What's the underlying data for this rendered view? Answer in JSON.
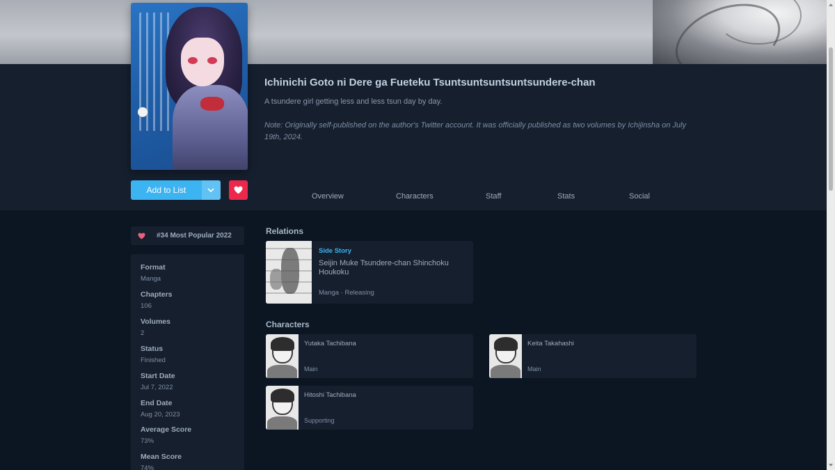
{
  "media": {
    "title": "Ichinichi Goto ni Dere ga Fueteku Tsuntsuntsuntsuntsundere-chan",
    "description": "A tsundere girl getting less and less tsun day by day.",
    "note": "Note: Originally self-published on the author's Twitter account. It was officially published as two volumes by Ichijinsha on July 19th, 2024."
  },
  "actions": {
    "add_label": "Add to List",
    "dropdown_icon": "chevron-down-icon",
    "favourite_icon": "heart-icon"
  },
  "tabs": [
    {
      "label": "Overview"
    },
    {
      "label": "Characters"
    },
    {
      "label": "Staff"
    },
    {
      "label": "Stats"
    },
    {
      "label": "Social"
    }
  ],
  "ranking": {
    "icon": "heart-icon",
    "label": "#34 Most Popular 2022"
  },
  "info": [
    {
      "key": "Format",
      "value": "Manga"
    },
    {
      "key": "Chapters",
      "value": "106"
    },
    {
      "key": "Volumes",
      "value": "2"
    },
    {
      "key": "Status",
      "value": "Finished"
    },
    {
      "key": "Start Date",
      "value": "Jul 7, 2022"
    },
    {
      "key": "End Date",
      "value": "Aug 20, 2023"
    },
    {
      "key": "Average Score",
      "value": "73%"
    },
    {
      "key": "Mean Score",
      "value": "74%"
    }
  ],
  "relations": {
    "heading": "Relations",
    "items": [
      {
        "type": "Side Story",
        "title": "Seijin Muke Tsundere-chan Shinchoku Houkoku",
        "meta": "Manga · Releasing"
      }
    ]
  },
  "characters": {
    "heading": "Characters",
    "items": [
      {
        "name": "Yutaka Tachibana",
        "role": "Main"
      },
      {
        "name": "Keita Takahashi",
        "role": "Main"
      },
      {
        "name": "Hitoshi Tachibana",
        "role": "Supporting"
      }
    ]
  },
  "colors": {
    "background": "#0b1622",
    "panel": "#151f2e",
    "accent_blue": "#3db4f2",
    "favourite_red": "#ec294b"
  }
}
